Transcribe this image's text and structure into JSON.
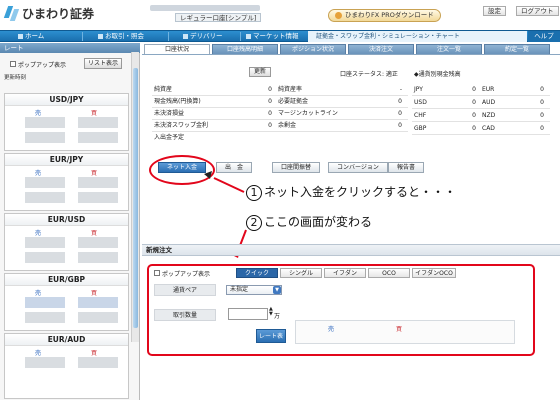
{
  "header": {
    "logo_text": "ひまわり証券",
    "plan_label": "レギュラー口座[シンプル]",
    "pro_download_label": "ひまわりFX PROダウンロード",
    "settings_label": "設定",
    "logout_label": "ログアウト"
  },
  "nav": {
    "items": [
      {
        "label": "ホーム"
      },
      {
        "label": "お取引・照会"
      },
      {
        "label": "デリバリー"
      },
      {
        "label": "マーケット情報"
      }
    ],
    "ticker": "証拠金・スワップ金利・シミュレーション・チャート",
    "help_label": "ヘルプ"
  },
  "rates_panel": {
    "title": "レート",
    "popup_label": "ポップアップ表示",
    "list_label": "リスト表示",
    "updated_label": "更新時刻",
    "sell_label": "売",
    "buy_label": "買",
    "pairs": [
      "USD/JPY",
      "EUR/JPY",
      "EUR/USD",
      "EUR/GBP",
      "EUR/AUD"
    ]
  },
  "tabs": [
    "口座状況",
    "口座残高明細",
    "ポジション状況",
    "決済注文",
    "注文一覧",
    "約定一覧"
  ],
  "account": {
    "refresh_label": "更新",
    "status_label": "口座ステータス: 適正",
    "note_label": "◆通貨別現金残高",
    "rows": [
      {
        "label": "純資産",
        "value": "0",
        "label2": "純資産率",
        "value2": "-"
      },
      {
        "label": "現金残高(円換算)",
        "value": "0",
        "label2": "必要証拠金",
        "value2": "0"
      },
      {
        "label": "未決済損益",
        "value": "0",
        "label2": "マージンカットライン",
        "value2": "0"
      },
      {
        "label": "未決済スワップ金利",
        "value": "0",
        "label2": "余剰金",
        "value2": "0"
      },
      {
        "label": "入出金予定",
        "value": "",
        "label2": "",
        "value2": ""
      }
    ],
    "currencies": [
      {
        "a": "JPY",
        "av": "0",
        "b": "EUR",
        "bv": "0"
      },
      {
        "a": "USD",
        "av": "0",
        "b": "AUD",
        "bv": "0"
      },
      {
        "a": "CHF",
        "av": "0",
        "b": "NZD",
        "bv": "0"
      },
      {
        "a": "GBP",
        "av": "0",
        "b": "CAD",
        "bv": "0"
      }
    ]
  },
  "actions": {
    "net_deposit": "ネット入金",
    "withdraw": "出　金",
    "transfer": "口座間振替",
    "conversion": "コンバージョン",
    "report": "報告書"
  },
  "callouts": {
    "n1": "1",
    "t1": "ネット入金をクリックすると・・・",
    "n2": "2",
    "t2": "ここの画面が変わる"
  },
  "new_order": {
    "title": "新規注文",
    "popup_label": "ポップアップ表示",
    "order_tabs": [
      "クイック",
      "シングル",
      "イフダン",
      "OCO",
      "イフダンOCO"
    ],
    "pair_label": "通貨ペア",
    "pair_value": "未指定",
    "qty_label": "取引数量",
    "qty_unit": "万",
    "rate_button": "レート表示",
    "sell_label": "売",
    "buy_label": "買"
  }
}
